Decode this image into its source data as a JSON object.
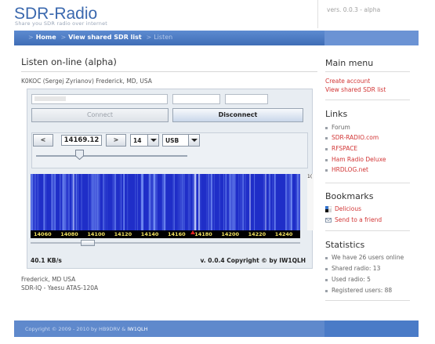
{
  "header": {
    "site_title": "SDR-Radio",
    "tagline": "Share you SDR radio over internet",
    "version": "vers. 0.0.3 - alpha"
  },
  "nav": {
    "home": "Home",
    "view_shared": "View shared SDR list",
    "current": "Listen"
  },
  "main": {
    "heading": "Listen on-line (alpha)",
    "station": "K0KOC (Sergej Zyrianov) Frederick, MD, USA",
    "applet": {
      "connect_label": "Connect",
      "disconnect_label": "Disconnect",
      "down_label": "<",
      "up_label": ">",
      "frequency": "14169.12",
      "step": "14",
      "mode": "USB",
      "data_rate": "40.1 KB/s",
      "copyright": "v. 0.0.4 Copyright © by IW1QLH",
      "scale_ticks": [
        "14060",
        "14080",
        "14100",
        "14120",
        "14140",
        "14160",
        "14180",
        "14200",
        "14220",
        "14240"
      ],
      "side_label": "1("
    },
    "location_line1": "Frederick, MD USA",
    "location_line2": "SDR-IQ - Yaesu ATAS-120A"
  },
  "sidebar": {
    "main_menu_title": "Main menu",
    "create_account": "Create account",
    "view_shared": "View shared SDR list",
    "links_title": "Links",
    "links": [
      "Forum",
      "SDR-RADIO.com",
      "RFSPACE",
      "Ham Radio Deluxe",
      "HRDLOG.net"
    ],
    "bookmarks_title": "Bookmarks",
    "bookmarks": [
      "Delicious",
      "Send to a friend"
    ],
    "stats_title": "Statistics",
    "stats": [
      "We have 26 users online",
      "Shared radio: 13",
      "Used radio: 5",
      "Registered users: 88"
    ]
  },
  "footer": {
    "text": "Copyright © 2009 - 2010 by HB9DRV & ",
    "author": "IW1QLH"
  }
}
